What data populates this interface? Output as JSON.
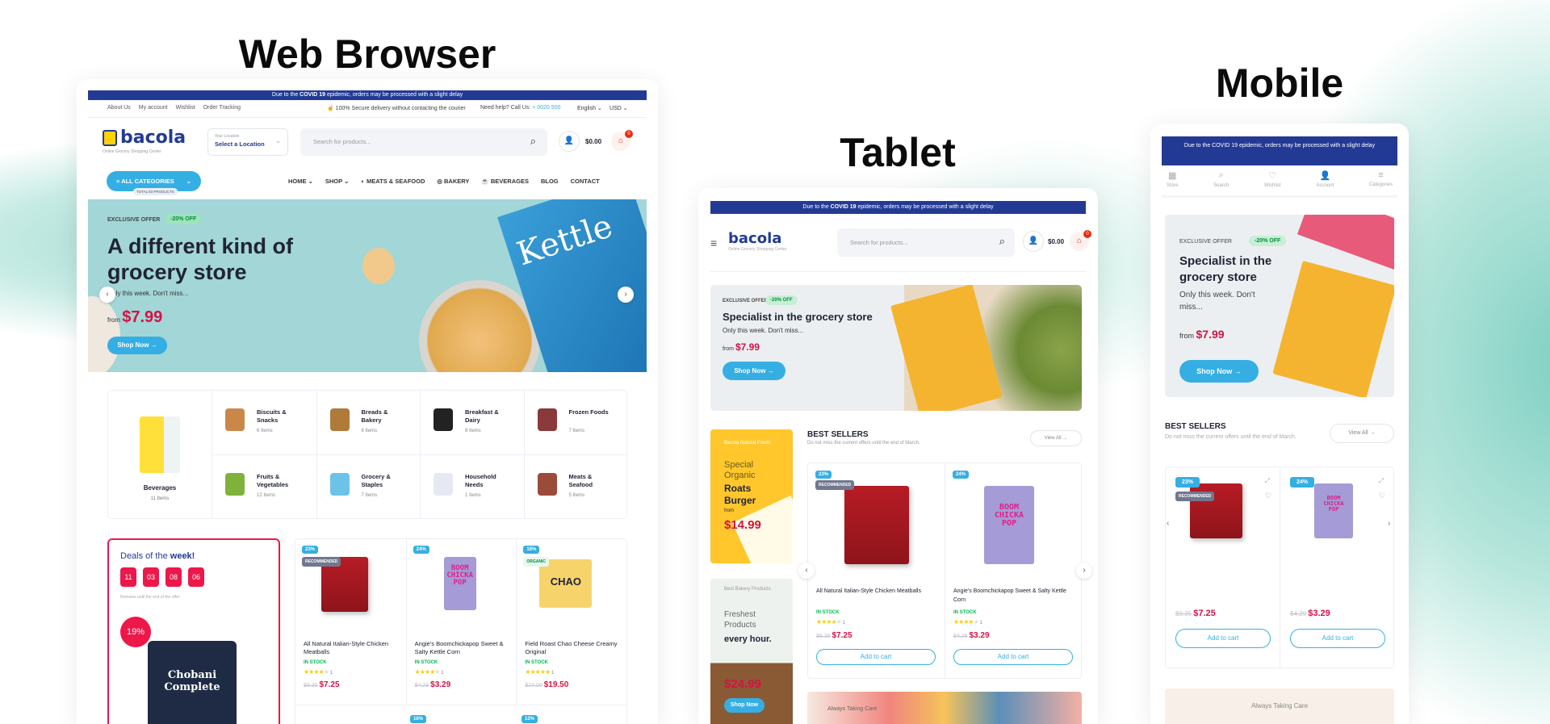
{
  "headings": {
    "web": "Web Browser",
    "tablet": "Tablet",
    "mobile": "Mobile"
  },
  "colors": {
    "primary": "#233a95",
    "accent": "#35afe3",
    "price": "#d51243",
    "stock": "#00b853",
    "bg_teal": "#9fd8cf"
  },
  "covid": {
    "pre": "Due to the ",
    "bold": "COVID 19",
    "post": " epidemic, orders may be processed with a slight delay"
  },
  "web": {
    "top_links": [
      "About Us",
      "My account",
      "Wishlist",
      "Order Tracking"
    ],
    "secure": "100% Secure delivery without contacting the courier",
    "help": "Need help? Call Us: ",
    "phone": "+ 0020 500",
    "language": "English",
    "currency": "USD",
    "logo": "bacola",
    "tagline": "Online Grocery Shopping Center",
    "location_label": "Your Location",
    "location_value": "Select a Location",
    "search_placeholder": "Search for products...",
    "cart_total": "$0.00",
    "cart_count": "0",
    "all_categories": "ALL CATEGORIES",
    "total_products": "TOTAL 63 PRODUCTS",
    "nav": [
      "HOME",
      "SHOP",
      "MEATS & SEAFOOD",
      "BAKERY",
      "BEVERAGES",
      "BLOG",
      "CONTACT"
    ],
    "hero": {
      "eyebrow": "EXCLUSIVE OFFER",
      "discount": "-20% OFF",
      "title": "A different kind of grocery store",
      "subtitle": "Only this week. Don't miss...",
      "from": "from",
      "price": "$7.99",
      "cta": "Shop Now",
      "pack_text": "Kettle"
    },
    "featured_category": {
      "name": "Beverages",
      "count": "11 Items"
    },
    "categories": [
      {
        "name": "Biscuits & Snacks",
        "count": "6 Items",
        "color": "#c9884a"
      },
      {
        "name": "Breads & Bakery",
        "count": "6 Items",
        "color": "#b07a3a"
      },
      {
        "name": "Breakfast & Dairy",
        "count": "8 Items",
        "color": "#222"
      },
      {
        "name": "Frozen Foods",
        "count": "7 Items",
        "color": "#8a3a3a"
      },
      {
        "name": "Fruits & Vegetables",
        "count": "12 Items",
        "color": "#7fb23a"
      },
      {
        "name": "Grocery & Staples",
        "count": "7 Items",
        "color": "#6cc3e8"
      },
      {
        "name": "Household Needs",
        "count": "1 Items",
        "color": "#e6e9f2"
      },
      {
        "name": "Meats & Seafood",
        "count": "5 Items",
        "color": "#9a4b3a"
      }
    ],
    "deals": {
      "title_pre": "Deals of the ",
      "title_bold": "week!",
      "timer": [
        "11",
        "03",
        "08",
        "06"
      ],
      "note": "Remains until the end of the offer",
      "discount": "19%",
      "product_label": "Chobani Complete"
    },
    "products": [
      {
        "discount": "23%",
        "tag": "RECOMMENDED",
        "name": "All Natural Italian-Style Chicken Meatballs",
        "stock": "IN STOCK",
        "rating": 4,
        "reviews": "1",
        "old": "$9.35",
        "price": "$7.25"
      },
      {
        "discount": "24%",
        "tag": "",
        "name": "Angie's Boomchickapop Sweet & Salty Kettle Corn",
        "stock": "IN STOCK",
        "rating": 4,
        "reviews": "1",
        "old": "$4.29",
        "price": "$3.29",
        "pack_text": "BOOM CHICKA POP"
      },
      {
        "discount": "19%",
        "tag": "ORGANIC",
        "name": "Field Roast Chao Cheese Creamy Original",
        "stock": "IN STOCK",
        "rating": 5,
        "reviews": "1",
        "old": "$24.00",
        "price": "$19.50",
        "pack_text": "CHAO"
      }
    ],
    "next_row_discounts": [
      "16%",
      "12%"
    ]
  },
  "tablet": {
    "logo": "bacola",
    "tagline": "Online Grocery Shopping Center",
    "search_placeholder": "Search for products...",
    "cart_total": "$0.00",
    "cart_count": "0",
    "hero": {
      "eyebrow": "EXCLUSIVE OFFER",
      "discount": "-20% OFF",
      "title": "Specialist in the grocery store",
      "subtitle": "Only this week. Don't miss...",
      "from": "from",
      "price": "$7.99",
      "cta": "Shop Now"
    },
    "banner1": {
      "kicker": "Bacola Natural Foods",
      "light": "Special Organic",
      "bold": "Roats Burger",
      "from": "from",
      "price": "$14.99"
    },
    "banner2": {
      "kicker": "Best Bakery Products",
      "light": "Freshest Products",
      "bold": "every hour.",
      "price": "$24.99",
      "cta": "Shop Now"
    },
    "best_sellers": {
      "title": "BEST SELLERS",
      "subtitle": "Do not miss the current offers until the end of March.",
      "view_all": "View All"
    },
    "products": [
      {
        "discount": "23%",
        "tag": "RECOMMENDED",
        "name": "All Natural Italian-Style Chicken Meatballs",
        "stock": "IN STOCK",
        "reviews": "1",
        "old": "$9.35",
        "price": "$7.25",
        "cta": "Add to cart"
      },
      {
        "discount": "24%",
        "name": "Angie's Boomchickapop Sweet & Salty Kettle Corn",
        "stock": "IN STOCK",
        "reviews": "1",
        "old": "$4.29",
        "price": "$3.29",
        "cta": "Add to cart"
      }
    ],
    "bottom_banner": "Always Taking Care"
  },
  "mobile": {
    "covid": "Due to the COVID 19 epidemic, orders may be processed with a slight delay",
    "nav": [
      "Store",
      "Search",
      "Wishlist",
      "Account",
      "Categories"
    ],
    "hero": {
      "eyebrow": "EXCLUSIVE OFFER",
      "discount": "-20% OFF",
      "title": "Specialist in the grocery store",
      "subtitle": "Only this week. Don't miss...",
      "from": "from",
      "price": "$7.99",
      "cta": "Shop Now"
    },
    "best_sellers": {
      "title": "BEST SELLERS",
      "subtitle": "Do not miss the current offers until the end of March.",
      "view_all": "View All"
    },
    "products": [
      {
        "discount": "23%",
        "tag": "RECOMMENDED",
        "old": "$9.35",
        "price": "$7.25",
        "cta": "Add to cart"
      },
      {
        "discount": "24%",
        "old": "$4.29",
        "price": "$3.29",
        "cta": "Add to cart"
      }
    ],
    "bottom_banner": "Always Taking Care"
  }
}
